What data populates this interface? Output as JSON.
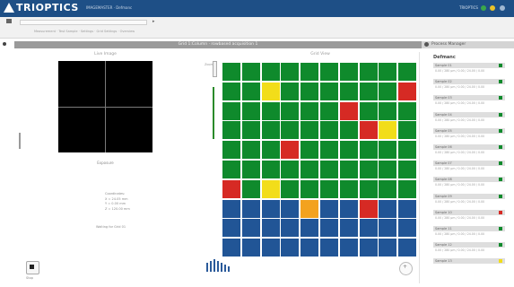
{
  "app": {
    "logo_text": "TRIOPTICS",
    "title": "IMAGEMASTER · Defmanc",
    "user_area": "TRIOPTICS"
  },
  "toolbar": {
    "breadcrumb": "Measurement · Test Sample · Settings · Grid Settings · Overview"
  },
  "section": {
    "title": "Grid 1:Column · rowbased acquisition 1",
    "prefs_title": "Process Manager"
  },
  "live": {
    "title": "Live Image",
    "exposure": "Exposure",
    "coords": [
      "Coordinates:",
      "X = 24.05 mm",
      "Y = 0.00 mm",
      "Z = 120.00 mm"
    ],
    "status": "Waiting for Grid 01",
    "stop_label": "Stop"
  },
  "grid_view": {
    "title": "Grid View",
    "zoom_label": "Zoom",
    "cols": 10,
    "rows": 10,
    "cells": [
      [
        "g",
        "g",
        "g",
        "g",
        "g",
        "g",
        "g",
        "g",
        "g",
        "g"
      ],
      [
        "g",
        "g",
        "y",
        "g",
        "g",
        "g",
        "g",
        "g",
        "g",
        "r"
      ],
      [
        "g",
        "g",
        "g",
        "g",
        "g",
        "g",
        "r",
        "g",
        "g",
        "g"
      ],
      [
        "g",
        "g",
        "g",
        "g",
        "g",
        "g",
        "g",
        "r",
        "y",
        "g"
      ],
      [
        "g",
        "g",
        "g",
        "r",
        "g",
        "g",
        "g",
        "g",
        "g",
        "g"
      ],
      [
        "g",
        "g",
        "g",
        "g",
        "g",
        "g",
        "g",
        "g",
        "g",
        "g"
      ],
      [
        "r",
        "g",
        "y",
        "g",
        "g",
        "g",
        "g",
        "g",
        "g",
        "g"
      ],
      [
        "b",
        "b",
        "b",
        "b",
        "o",
        "b",
        "b",
        "r",
        "b",
        "b"
      ],
      [
        "b",
        "b",
        "b",
        "b",
        "b",
        "b",
        "b",
        "b",
        "b",
        "b"
      ],
      [
        "b",
        "b",
        "b",
        "b",
        "b",
        "b",
        "b",
        "b",
        "b",
        "b"
      ]
    ]
  },
  "colors": {
    "g": "#0f8a2c",
    "y": "#f2dd1a",
    "r": "#d62a24",
    "b": "#215596",
    "o": "#f3a21f"
  },
  "settings": {
    "title": "Defmanc",
    "items": [
      {
        "name": "Sample 01",
        "value": "0.00 / 280 µm / 0.00 / 24.00 / 0.00",
        "status": "g"
      },
      {
        "name": "Sample 02",
        "value": "0.00 / 280 µm / 0.00 / 24.00 / 0.00",
        "status": "g"
      },
      {
        "name": "Sample 03",
        "value": "0.00 / 280 µm / 0.00 / 24.00 / 0.00",
        "status": "g"
      },
      {
        "name": "Sample 04",
        "value": "0.00 / 280 µm / 0.00 / 24.00 / 0.00",
        "status": "g"
      },
      {
        "name": "Sample 05",
        "value": "0.00 / 280 µm / 0.00 / 24.00 / 0.00",
        "status": "g"
      },
      {
        "name": "Sample 06",
        "value": "0.00 / 280 µm / 0.00 / 24.00 / 0.00",
        "status": "g"
      },
      {
        "name": "Sample 07",
        "value": "0.00 / 280 µm / 0.00 / 24.00 / 0.00",
        "status": "g"
      },
      {
        "name": "Sample 08",
        "value": "0.00 / 280 µm / 0.00 / 24.00 / 0.00",
        "status": "g"
      },
      {
        "name": "Sample 09",
        "value": "0.00 / 280 µm / 0.00 / 24.00 / 0.00",
        "status": "g"
      },
      {
        "name": "Sample 10",
        "value": "0.00 / 280 µm / 0.00 / 24.00 / 0.00",
        "status": "r"
      },
      {
        "name": "Sample 11",
        "value": "0.00 / 280 µm / 0.00 / 24.00 / 0.00",
        "status": "g"
      },
      {
        "name": "Sample 12",
        "value": "0.00 / 280 µm / 0.00 / 24.00 / 0.00",
        "status": "g"
      },
      {
        "name": "Sample 13",
        "value": "",
        "status": "y"
      }
    ]
  }
}
